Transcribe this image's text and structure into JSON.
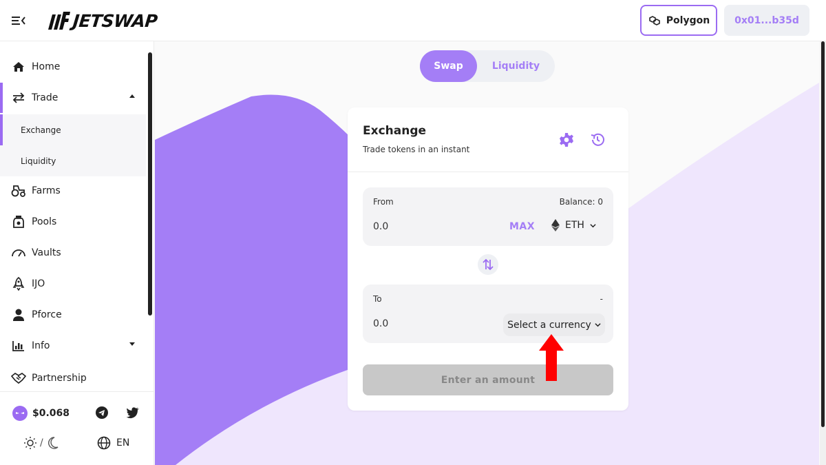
{
  "header": {
    "logo_text": "JETSWAP",
    "network_label": "Polygon",
    "wallet_label": "0x01...b35d"
  },
  "sidebar": {
    "items": [
      {
        "label": "Home",
        "icon": "home-icon"
      },
      {
        "label": "Trade",
        "icon": "swap-arrows-icon",
        "expanded": true
      },
      {
        "label": "Exchange",
        "sub": true,
        "active": true
      },
      {
        "label": "Liquidity",
        "sub": true
      },
      {
        "label": "Farms",
        "icon": "tractor-icon"
      },
      {
        "label": "Pools",
        "icon": "jar-icon"
      },
      {
        "label": "Vaults",
        "icon": "gauge-icon"
      },
      {
        "label": "IJO",
        "icon": "rocket-icon"
      },
      {
        "label": "Pforce",
        "icon": "agent-icon"
      },
      {
        "label": "Info",
        "icon": "chart-icon",
        "expanded": false
      },
      {
        "label": "Partnership",
        "icon": "handshake-icon"
      }
    ],
    "price": "$0.068",
    "theme_separator": "/",
    "language": "EN"
  },
  "tabs": {
    "swap": "Swap",
    "liquidity": "Liquidity"
  },
  "exchange": {
    "title": "Exchange",
    "subtitle": "Trade tokens in an instant",
    "from": {
      "label": "From",
      "balance": "Balance: 0",
      "amount": "0.0",
      "max": "MAX",
      "token": "ETH"
    },
    "to": {
      "label": "To",
      "balance": "-",
      "amount": "0.0",
      "select_label": "Select a currency"
    },
    "submit_label": "Enter an amount"
  },
  "colors": {
    "accent": "#a47ef6",
    "accent_dark": "#9b6bf2",
    "wave_light": "#efe6fd",
    "annotation_arrow": "#ff0000"
  }
}
